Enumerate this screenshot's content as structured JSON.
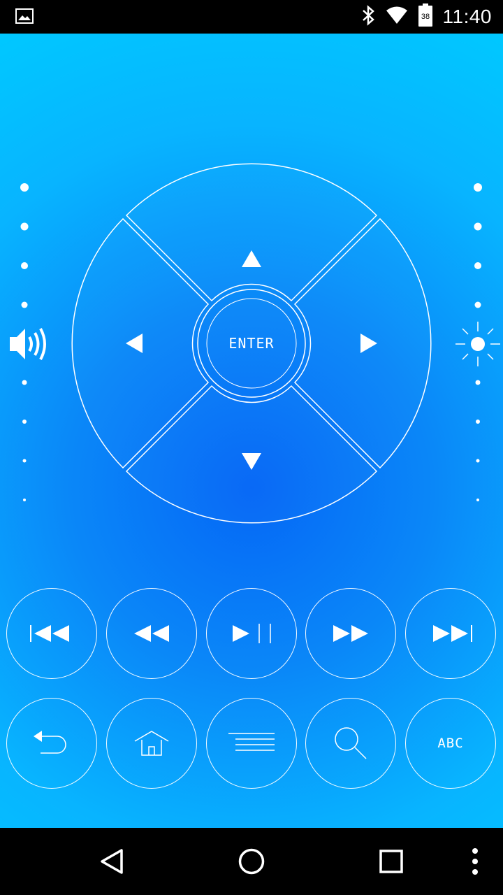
{
  "status_bar": {
    "time": "11:40",
    "battery_level": "38",
    "icons": [
      "image-icon",
      "bluetooth-icon",
      "wifi-icon",
      "battery-icon"
    ]
  },
  "dpad": {
    "enter_label": "ENTER"
  },
  "side_controls": {
    "volume_icon": "volume-icon",
    "brightness_icon": "brightness-icon"
  },
  "media_row": [
    "skip-previous-icon",
    "rewind-icon",
    "play-pause-icon",
    "fast-forward-icon",
    "skip-next-icon"
  ],
  "function_row": {
    "back_icon": "back-icon",
    "home_icon": "home-icon",
    "menu_icon": "menu-icon",
    "search_icon": "search-icon",
    "keyboard_label": "ABC"
  },
  "colors": {
    "gradient_center": "#0567f6",
    "gradient_edge": "#00c8ff",
    "line": "#ffffff"
  }
}
